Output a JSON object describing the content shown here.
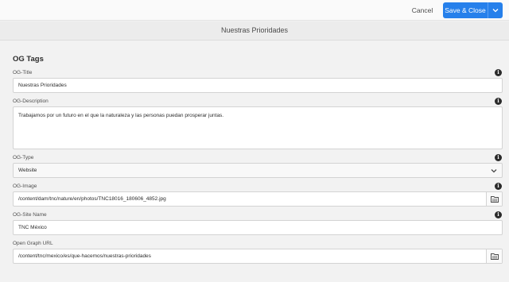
{
  "toolbar": {
    "cancel_label": "Cancel",
    "save_label": "Save & Close",
    "accent": "#2680eb"
  },
  "page": {
    "title": "Nuestras Prioridades"
  },
  "section": {
    "title": "OG Tags"
  },
  "fields": {
    "og_title": {
      "label": "OG-Title",
      "value": "Nuestras Prioridades"
    },
    "og_description": {
      "label": "OG-Description",
      "value": "Trabajamos por un futuro en el que la naturaleza y las personas puedan prosperar juntas."
    },
    "og_type": {
      "label": "OG-Type",
      "value": "Website"
    },
    "og_image": {
      "label": "OG-Image",
      "value": "/content/dam/tnc/nature/en/photos/TNC18016_180606_4852.jpg"
    },
    "og_site_name": {
      "label": "OG-Site Name",
      "value": "TNC México"
    },
    "og_url": {
      "label": "Open Graph URL",
      "value": "/content/tnc/mexico/es/que-hacemos/nuestras-prioridades"
    }
  },
  "icons": {
    "info": "info-icon",
    "chevron": "chevron-down-icon",
    "picker": "folder-browse-icon"
  }
}
